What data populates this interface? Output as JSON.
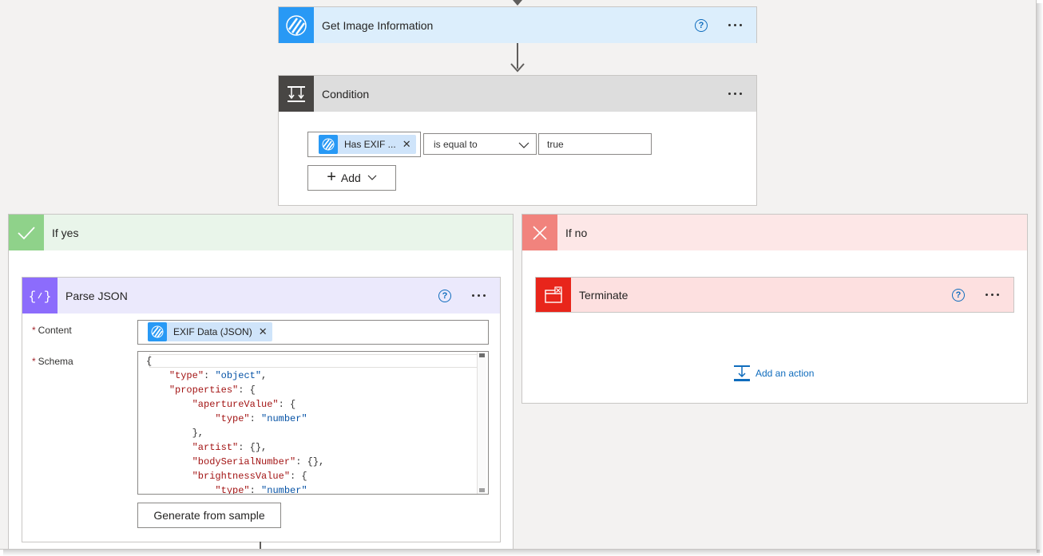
{
  "get_image": {
    "title": "Get Image Information",
    "help": "?"
  },
  "condition": {
    "title": "Condition",
    "left_token": "Has EXIF ...",
    "operator": "is equal to",
    "value": "true",
    "add_label": "Add"
  },
  "branch_yes": {
    "title": "If yes"
  },
  "branch_no": {
    "title": "If no"
  },
  "parse_json": {
    "title": "Parse JSON",
    "help": "?",
    "content_label": "Content",
    "content_token": "EXIF Data (JSON)",
    "schema_label": "Schema",
    "required_mark": "*",
    "generate_label": "Generate from sample",
    "schema_lines": [
      "{",
      "    \"type\": \"object\",",
      "    \"properties\": {",
      "        \"apertureValue\": {",
      "            \"type\": \"number\"",
      "        },",
      "        \"artist\": {},",
      "        \"bodySerialNumber\": {},",
      "        \"brightnessValue\": {",
      "            \"type\": \"number\""
    ]
  },
  "terminate": {
    "title": "Terminate",
    "help": "?"
  },
  "add_action": {
    "label": "Add an action"
  },
  "colors": {
    "get_image_header": "#dceefc",
    "get_image_icon": "#2899f5",
    "condition_header": "#dddddd",
    "condition_icon": "#484644",
    "yes_header": "#e9f5ea",
    "yes_icon": "#8fd28a",
    "no_header": "#fde7e7",
    "no_icon": "#f1837d",
    "parse_header": "#ebe9fc",
    "parse_icon": "#8c6cfc",
    "terminate_header": "#fde0e0",
    "terminate_icon": "#e8251b",
    "link": "#0f6cbd"
  },
  "icons": {
    "get_image": "striped-logo-icon",
    "condition": "condition-icon",
    "yes": "check-icon",
    "no": "close-icon",
    "parse": "braces-icon",
    "terminate": "terminate-icon",
    "add_action": "add-action-icon"
  }
}
